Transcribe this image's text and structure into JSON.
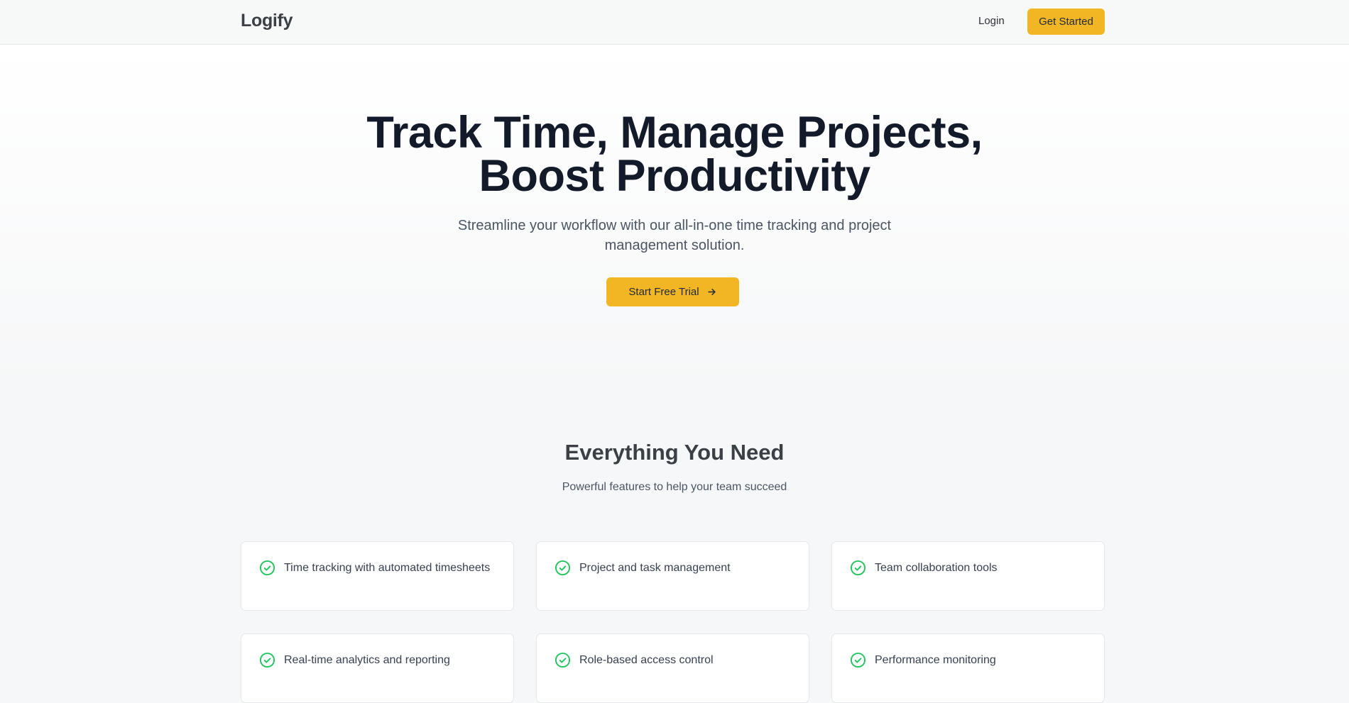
{
  "nav": {
    "logo": "Logify",
    "login_label": "Login",
    "cta_label": "Get Started"
  },
  "hero": {
    "title_line1": "Track Time, Manage Projects,",
    "title_line2": "Boost Productivity",
    "subtitle": "Streamline your workflow with our all-in-one time tracking and project management solution.",
    "cta_label": "Start Free Trial",
    "cta_icon": "arrow-right-icon"
  },
  "features": {
    "title": "Everything You Need",
    "subtitle": "Powerful features to help your team succeed",
    "icon": "check-circle-icon",
    "items": [
      {
        "label": "Time tracking with automated timesheets"
      },
      {
        "label": "Project and task management"
      },
      {
        "label": "Team collaboration tools"
      },
      {
        "label": "Real-time analytics and reporting"
      },
      {
        "label": "Role-based access control"
      },
      {
        "label": "Performance monitoring"
      }
    ]
  },
  "colors": {
    "accent": "#f2b624",
    "check": "#22c55e",
    "heading": "#131a2a"
  }
}
